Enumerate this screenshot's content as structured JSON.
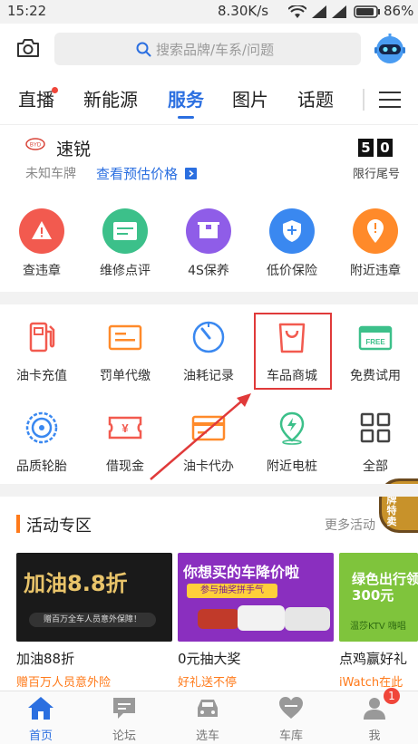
{
  "status_bar": {
    "time": "15:22",
    "speed": "8.30K/s",
    "battery": "86%"
  },
  "search": {
    "placeholder": "搜索品牌/车系/问题"
  },
  "tabs": [
    {
      "label": "直播",
      "badge": true
    },
    {
      "label": "新能源"
    },
    {
      "label": "服务",
      "active": true
    },
    {
      "label": "图片"
    },
    {
      "label": "话题"
    }
  ],
  "car": {
    "name": "速锐",
    "plate": "未知车牌",
    "price_link": "查看预估价格",
    "tail_digits": [
      "5",
      "0"
    ],
    "tail_label": "限行尾号"
  },
  "services_row1": [
    {
      "label": "查违章",
      "icon": "warning-icon",
      "color": "#f25a4f"
    },
    {
      "label": "维修点评",
      "icon": "card-icon",
      "color": "#3cc08a"
    },
    {
      "label": "4S保养",
      "icon": "box-icon",
      "color": "#8f5de8"
    },
    {
      "label": "低价保险",
      "icon": "shield-plus-icon",
      "color": "#3a88f0"
    },
    {
      "label": "附近违章",
      "icon": "location-alert-icon",
      "color": "#ff8a2a"
    }
  ],
  "services_row2": [
    {
      "label": "油卡充值",
      "icon": "fuel-pump-icon",
      "color": "#f25a4f"
    },
    {
      "label": "罚单代缴",
      "icon": "ticket-icon",
      "color": "#ff8a2a"
    },
    {
      "label": "油耗记录",
      "icon": "gauge-icon",
      "color": "#3a88f0"
    },
    {
      "label": "车品商城",
      "icon": "shopping-bag-icon",
      "color": "#f25a4f"
    },
    {
      "label": "免费试用",
      "icon": "free-tag-icon",
      "color": "#3cc08a"
    }
  ],
  "services_row3": [
    {
      "label": "品质轮胎",
      "icon": "tire-icon",
      "color": "#3a88f0"
    },
    {
      "label": "借现金",
      "icon": "yen-ticket-icon",
      "color": "#f25a4f"
    },
    {
      "label": "油卡代办",
      "icon": "card-icon",
      "color": "#ff8a2a"
    },
    {
      "label": "附近电桩",
      "icon": "charging-pin-icon",
      "color": "#3cc08a"
    },
    {
      "label": "全部",
      "icon": "grid-icon",
      "color": "#444444"
    }
  ],
  "floating_badge": "王牌特卖",
  "activity": {
    "title": "活动专区",
    "more": "更多活动",
    "cards": [
      {
        "banner": "加油8.8折",
        "banner_sub": "赠百万全车人员意外保障！",
        "title": "加油88折",
        "subtitle": "赠百万人员意外险"
      },
      {
        "banner": "你想买的车降价啦",
        "banner_sub": "参与抽奖拼手气",
        "title": "0元抽大奖",
        "subtitle": "好礼送不停"
      },
      {
        "banner": "绿色出行领300元",
        "banner_sub": "温莎KTV 嗨唱",
        "title": "点鸡赢好礼",
        "subtitle": "iWatch在此"
      }
    ]
  },
  "bottom_nav": [
    {
      "label": "首页",
      "active": true
    },
    {
      "label": "论坛"
    },
    {
      "label": "选车"
    },
    {
      "label": "车库"
    },
    {
      "label": "我",
      "badge": "1"
    }
  ]
}
